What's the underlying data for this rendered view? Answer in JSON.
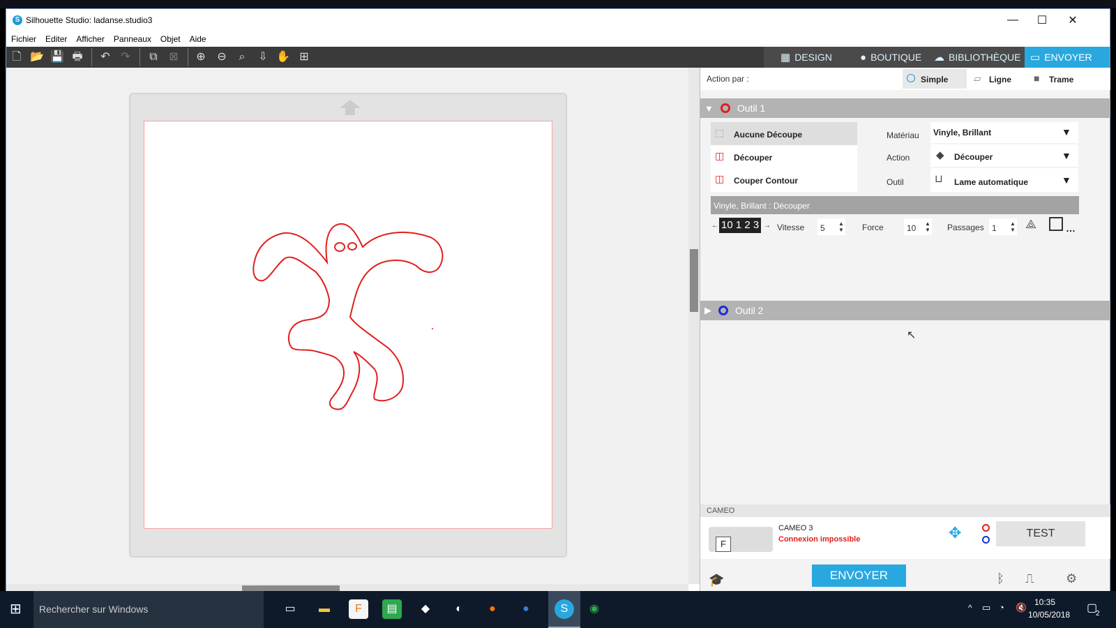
{
  "window": {
    "title": "Silhouette Studio: ladanse.studio3",
    "minimize": "—",
    "maximize": "☐",
    "close": "✕"
  },
  "menu": [
    "Fichier",
    "Editer",
    "Afficher",
    "Panneaux",
    "Objet",
    "Aide"
  ],
  "nav": {
    "design": "DESIGN",
    "boutique": "BOUTIQUE",
    "bibliotheque": "BIBLIOTHÈQUE",
    "envoyer": "ENVOYER"
  },
  "action_par": {
    "label": "Action par :",
    "simple": "Simple",
    "ligne": "Ligne",
    "trame": "Trame"
  },
  "tool1": {
    "title": "Outil 1",
    "options": [
      "Aucune Découpe",
      "Découper",
      "Couper Contour"
    ],
    "materiau_label": "Matériau",
    "materiau_value": "Vinyle, Brillant",
    "action_label": "Action",
    "action_value": "Découper",
    "outil_label": "Outil",
    "outil_value": "Lame automatique",
    "summary": "Vinyle, Brillant : Découper",
    "blade": "10 1 2 3",
    "vitesse_label": "Vitesse",
    "vitesse": "5",
    "force_label": "Force",
    "force": "10",
    "passages_label": "Passages",
    "passages": "1"
  },
  "tool2": {
    "title": "Outil 2"
  },
  "machine": {
    "section": "CAMEO",
    "name": "CAMEO 3",
    "status": "Connexion impossible",
    "test": "TEST",
    "send": "ENVOYER",
    "thumb_letter": "F"
  },
  "taskbar": {
    "search": "Rechercher sur Windows",
    "time": "10:35",
    "date": "10/05/2018",
    "notifications": "2"
  },
  "colors": {
    "accent": "#29a8e0",
    "error": "#e21e1e",
    "tool1": "#e21e1e",
    "tool2": "#1a2fd8",
    "toolbar": "#3a3a3a"
  },
  "icons": [
    "new-file-icon",
    "open-folder-icon",
    "save-icon",
    "print-icon",
    "undo-icon",
    "redo-icon",
    "group-icon",
    "ungroup-icon",
    "zoom-in-icon",
    "zoom-out-icon",
    "zoom-fit-icon",
    "move-icon",
    "pan-icon",
    "add-page-icon"
  ]
}
